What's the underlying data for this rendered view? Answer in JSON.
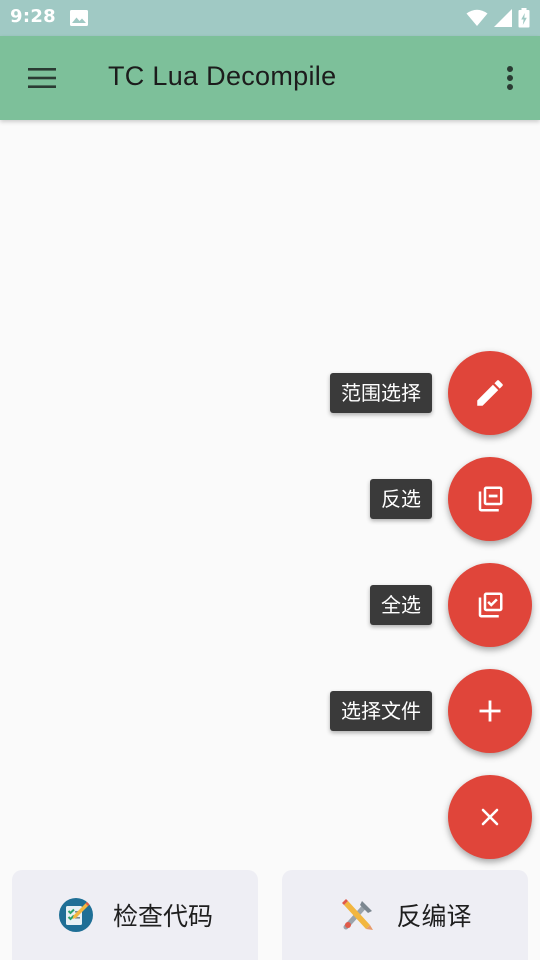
{
  "status_bar": {
    "time": "9:28",
    "icons": [
      "image-icon",
      "wifi-icon",
      "signal-icon",
      "battery-charging-icon"
    ]
  },
  "app_bar": {
    "title": "TC Lua Decompile",
    "left_icon": "menu-icon",
    "right_icon": "overflow-menu-icon"
  },
  "fab_menu": {
    "items": [
      {
        "label": "范围选择",
        "icon": "pencil-icon"
      },
      {
        "label": "反选",
        "icon": "invert-selection-icon"
      },
      {
        "label": "全选",
        "icon": "select-all-icon"
      },
      {
        "label": "选择文件",
        "icon": "plus-icon"
      }
    ],
    "close_icon": "close-icon"
  },
  "bottom_buttons": [
    {
      "label": "检查代码",
      "icon": "code-check-icon"
    },
    {
      "label": "反编译",
      "icon": "decompile-tools-icon"
    }
  ],
  "colors": {
    "status_bar": "#a0c9c4",
    "app_bar": "#7dc09a",
    "fab": "#e0453a",
    "fab_label_bg": "#3a3a3a",
    "background": "#fafafa",
    "bottom_button_bg": "#eeeef4"
  }
}
